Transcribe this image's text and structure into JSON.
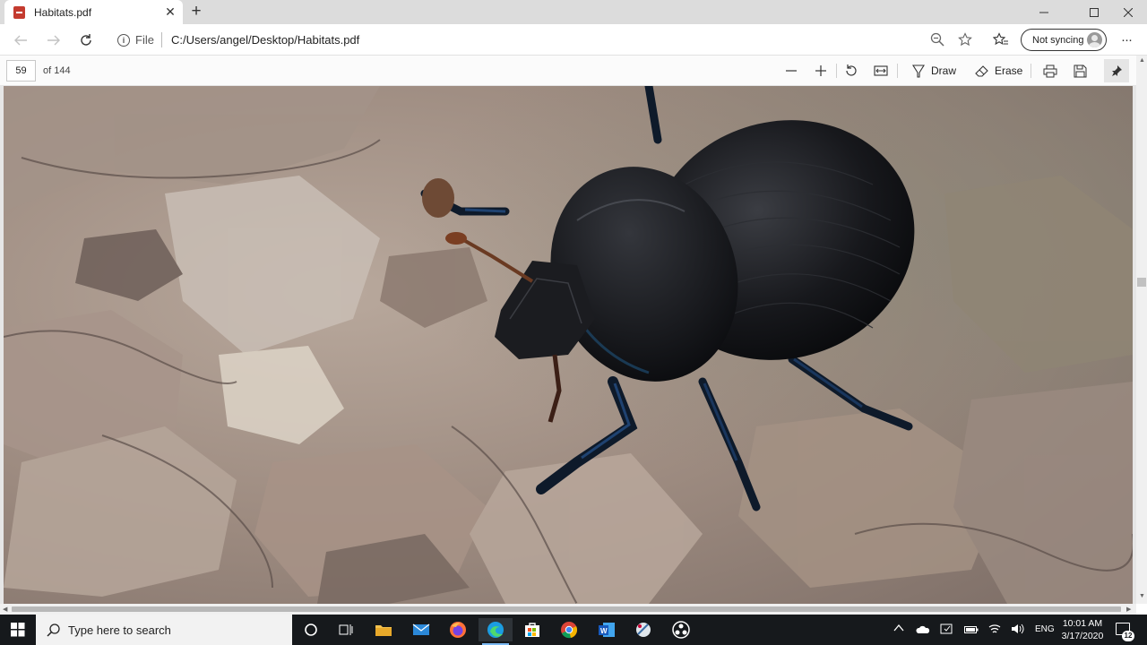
{
  "browser": {
    "tab": {
      "title": "Habitats.pdf",
      "close": "✕"
    },
    "new_tab": "+",
    "window_controls": {
      "minimize": "—",
      "maximize": "☐",
      "close": "✕"
    },
    "address": {
      "scheme": "File",
      "url": "C:/Users/angel/Desktop/Habitats.pdf"
    },
    "sync": {
      "label": "Not syncing"
    },
    "more": "···"
  },
  "pdf_toolbar": {
    "page_number": "59",
    "page_total": "of 144",
    "draw_label": "Draw",
    "erase_label": "Erase"
  },
  "document": {
    "image_subject": "beetle-on-bark-photo"
  },
  "taskbar": {
    "search_placeholder": "Type here to search",
    "language": "ENG",
    "time": "10:01 AM",
    "date": "3/17/2020",
    "notification_count": "12"
  },
  "colors": {
    "tabstrip": "#dcdcdc",
    "taskbar": "#16191c",
    "accent": "#7cb9f3",
    "pdf_red": "#c43b2f"
  }
}
